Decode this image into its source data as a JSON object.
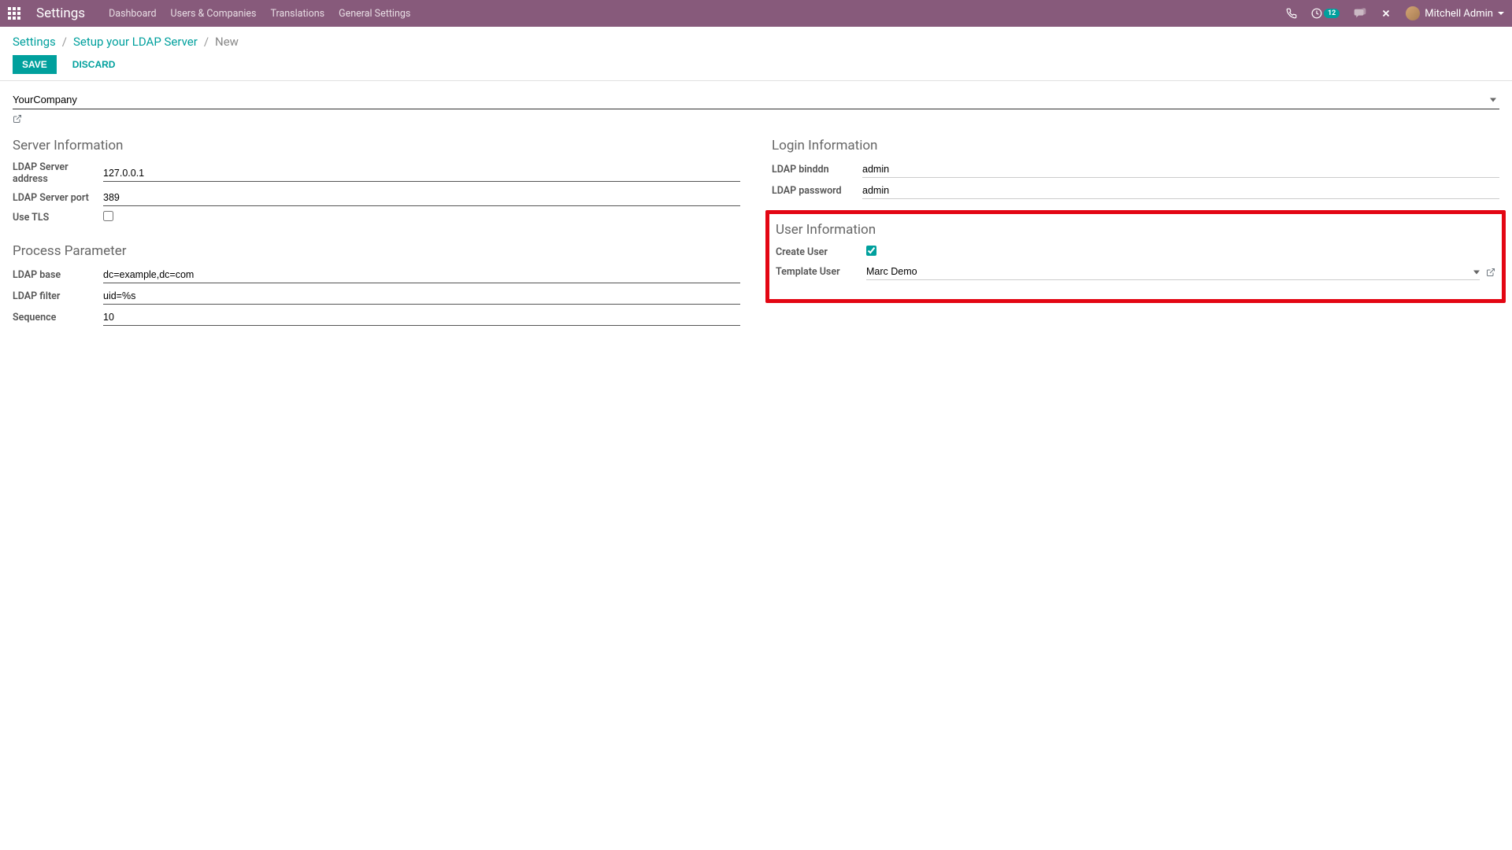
{
  "header": {
    "brand": "Settings",
    "nav": [
      "Dashboard",
      "Users & Companies",
      "Translations",
      "General Settings"
    ],
    "activity_count": "12",
    "user_name": "Mitchell Admin"
  },
  "breadcrumb": {
    "items": [
      "Settings",
      "Setup your LDAP Server"
    ],
    "current": "New"
  },
  "buttons": {
    "save": "SAVE",
    "discard": "DISCARD"
  },
  "company": {
    "value": "YourCompany"
  },
  "sections": {
    "server_info": {
      "title": "Server Information",
      "fields": {
        "address": {
          "label": "LDAP Server address",
          "value": "127.0.0.1"
        },
        "port": {
          "label": "LDAP Server port",
          "value": "389"
        },
        "tls": {
          "label": "Use TLS",
          "checked": false
        }
      }
    },
    "process_param": {
      "title": "Process Parameter",
      "fields": {
        "base": {
          "label": "LDAP base",
          "value": "dc=example,dc=com"
        },
        "filter": {
          "label": "LDAP filter",
          "value": "uid=%s"
        },
        "sequence": {
          "label": "Sequence",
          "value": "10"
        }
      }
    },
    "login_info": {
      "title": "Login Information",
      "fields": {
        "binddn": {
          "label": "LDAP binddn",
          "value": "admin"
        },
        "password": {
          "label": "LDAP password",
          "value": "admin"
        }
      }
    },
    "user_info": {
      "title": "User Information",
      "fields": {
        "create_user": {
          "label": "Create User",
          "checked": true
        },
        "template_user": {
          "label": "Template User",
          "value": "Marc Demo"
        }
      }
    }
  }
}
